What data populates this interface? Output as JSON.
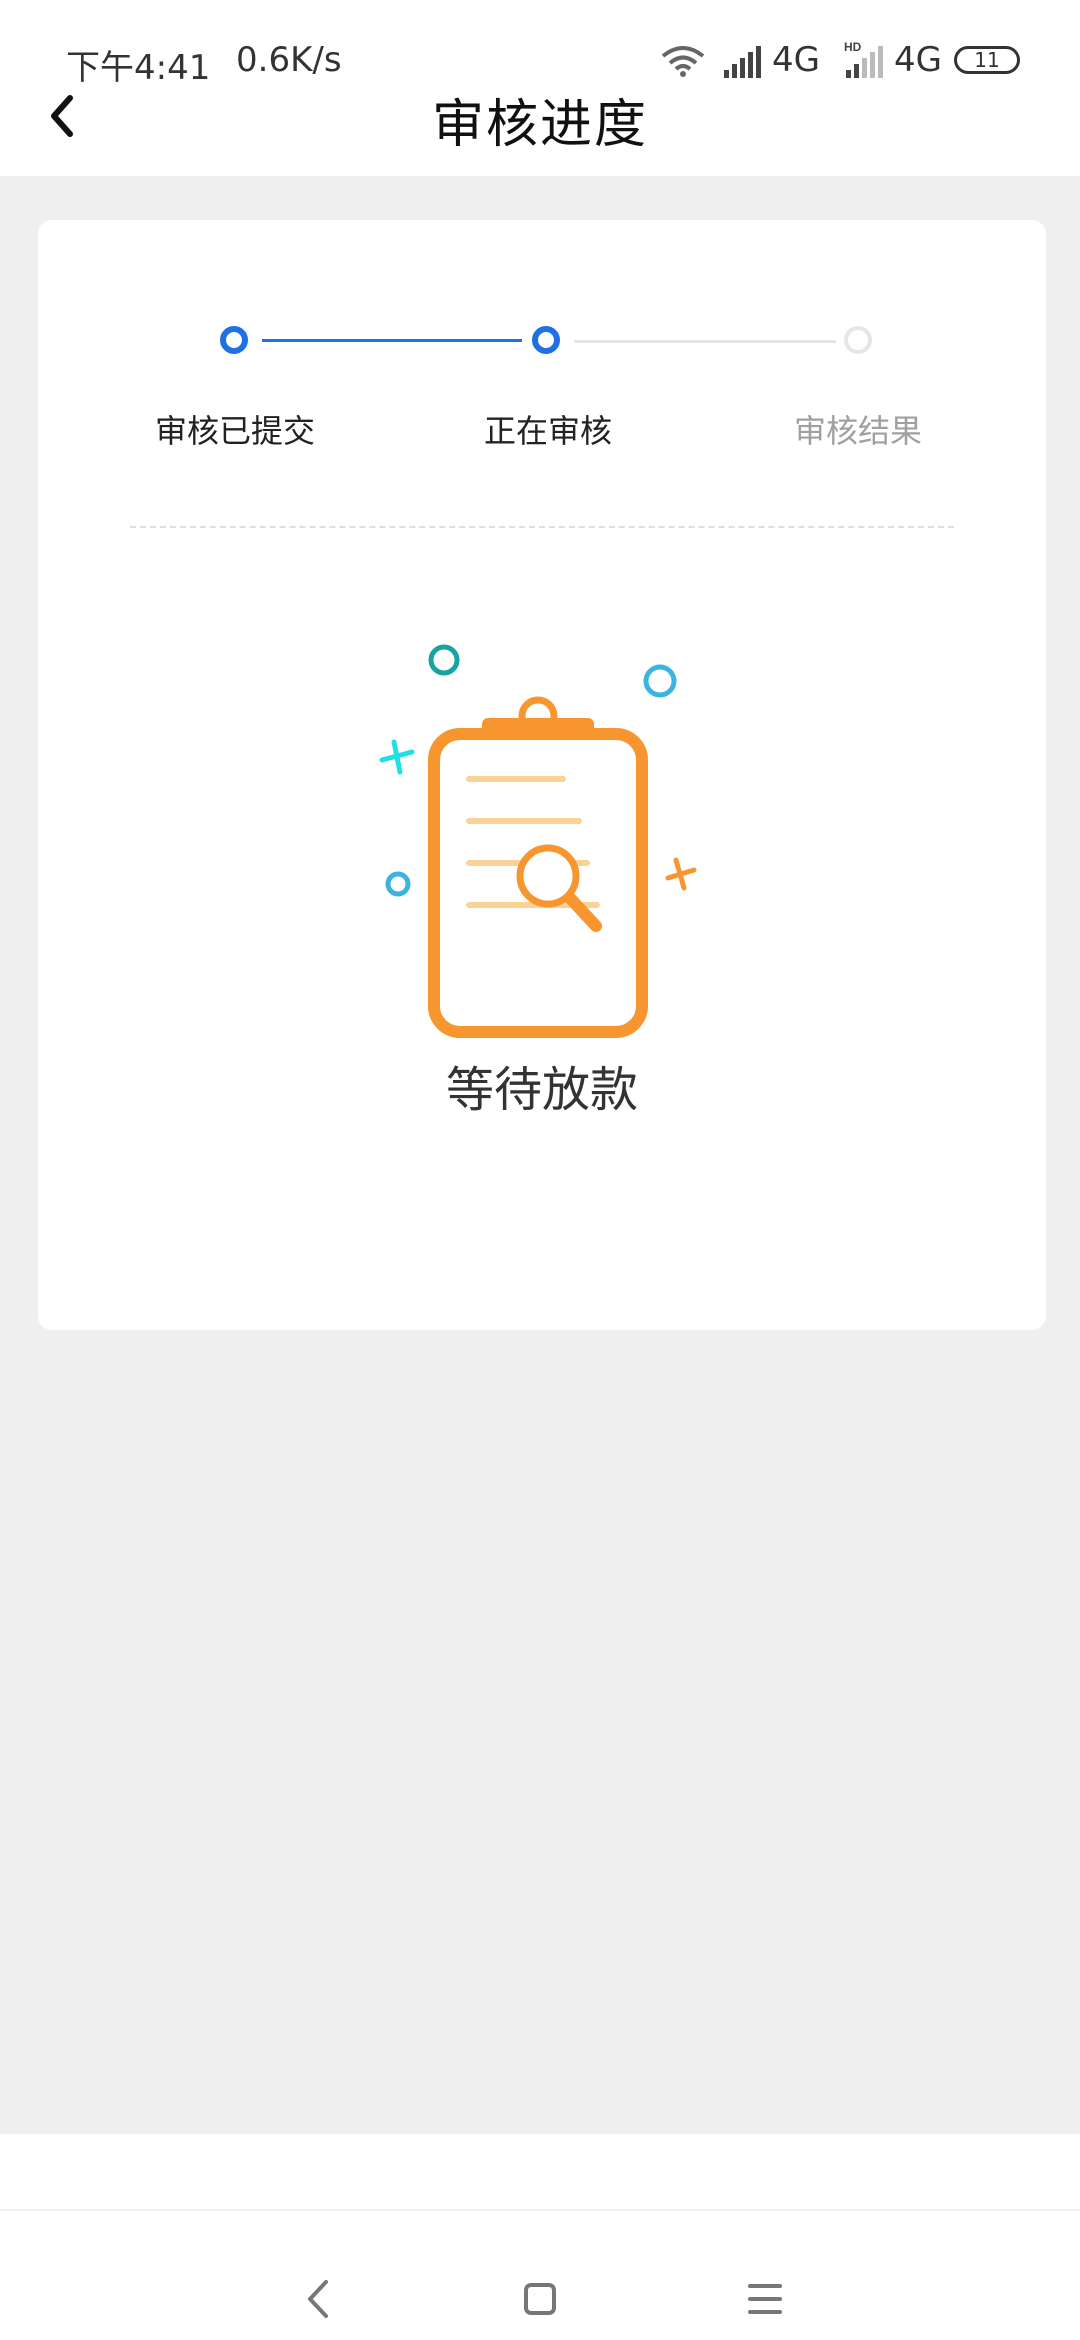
{
  "status_bar": {
    "time": "下午4:41",
    "speed": "0.6K/s",
    "network1": "4G",
    "network2": "4G",
    "battery": "11"
  },
  "nav": {
    "title": "审核进度"
  },
  "progress": {
    "steps": [
      {
        "label": "审核已提交",
        "state": "done"
      },
      {
        "label": "正在审核",
        "state": "current"
      },
      {
        "label": "审核结果",
        "state": "pending"
      }
    ],
    "active_color": "#1f6fe5",
    "inactive_color": "#e6e6e6"
  },
  "result": {
    "status_text": "等待放款",
    "icon": "clipboard-search-icon",
    "accent": "#f7962e"
  }
}
